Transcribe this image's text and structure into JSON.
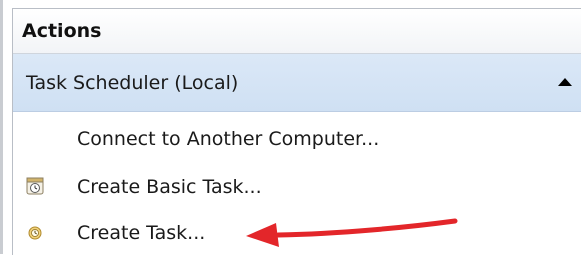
{
  "panel": {
    "title": "Actions"
  },
  "section": {
    "label": "Task Scheduler (Local)"
  },
  "actions": [
    {
      "label": "Connect to Another Computer...",
      "icon": "none"
    },
    {
      "label": "Create Basic Task...",
      "icon": "calendar-clock-icon"
    },
    {
      "label": "Create Task...",
      "icon": "task-clock-icon"
    }
  ],
  "annotation": {
    "arrow_color": "#e3262a"
  }
}
